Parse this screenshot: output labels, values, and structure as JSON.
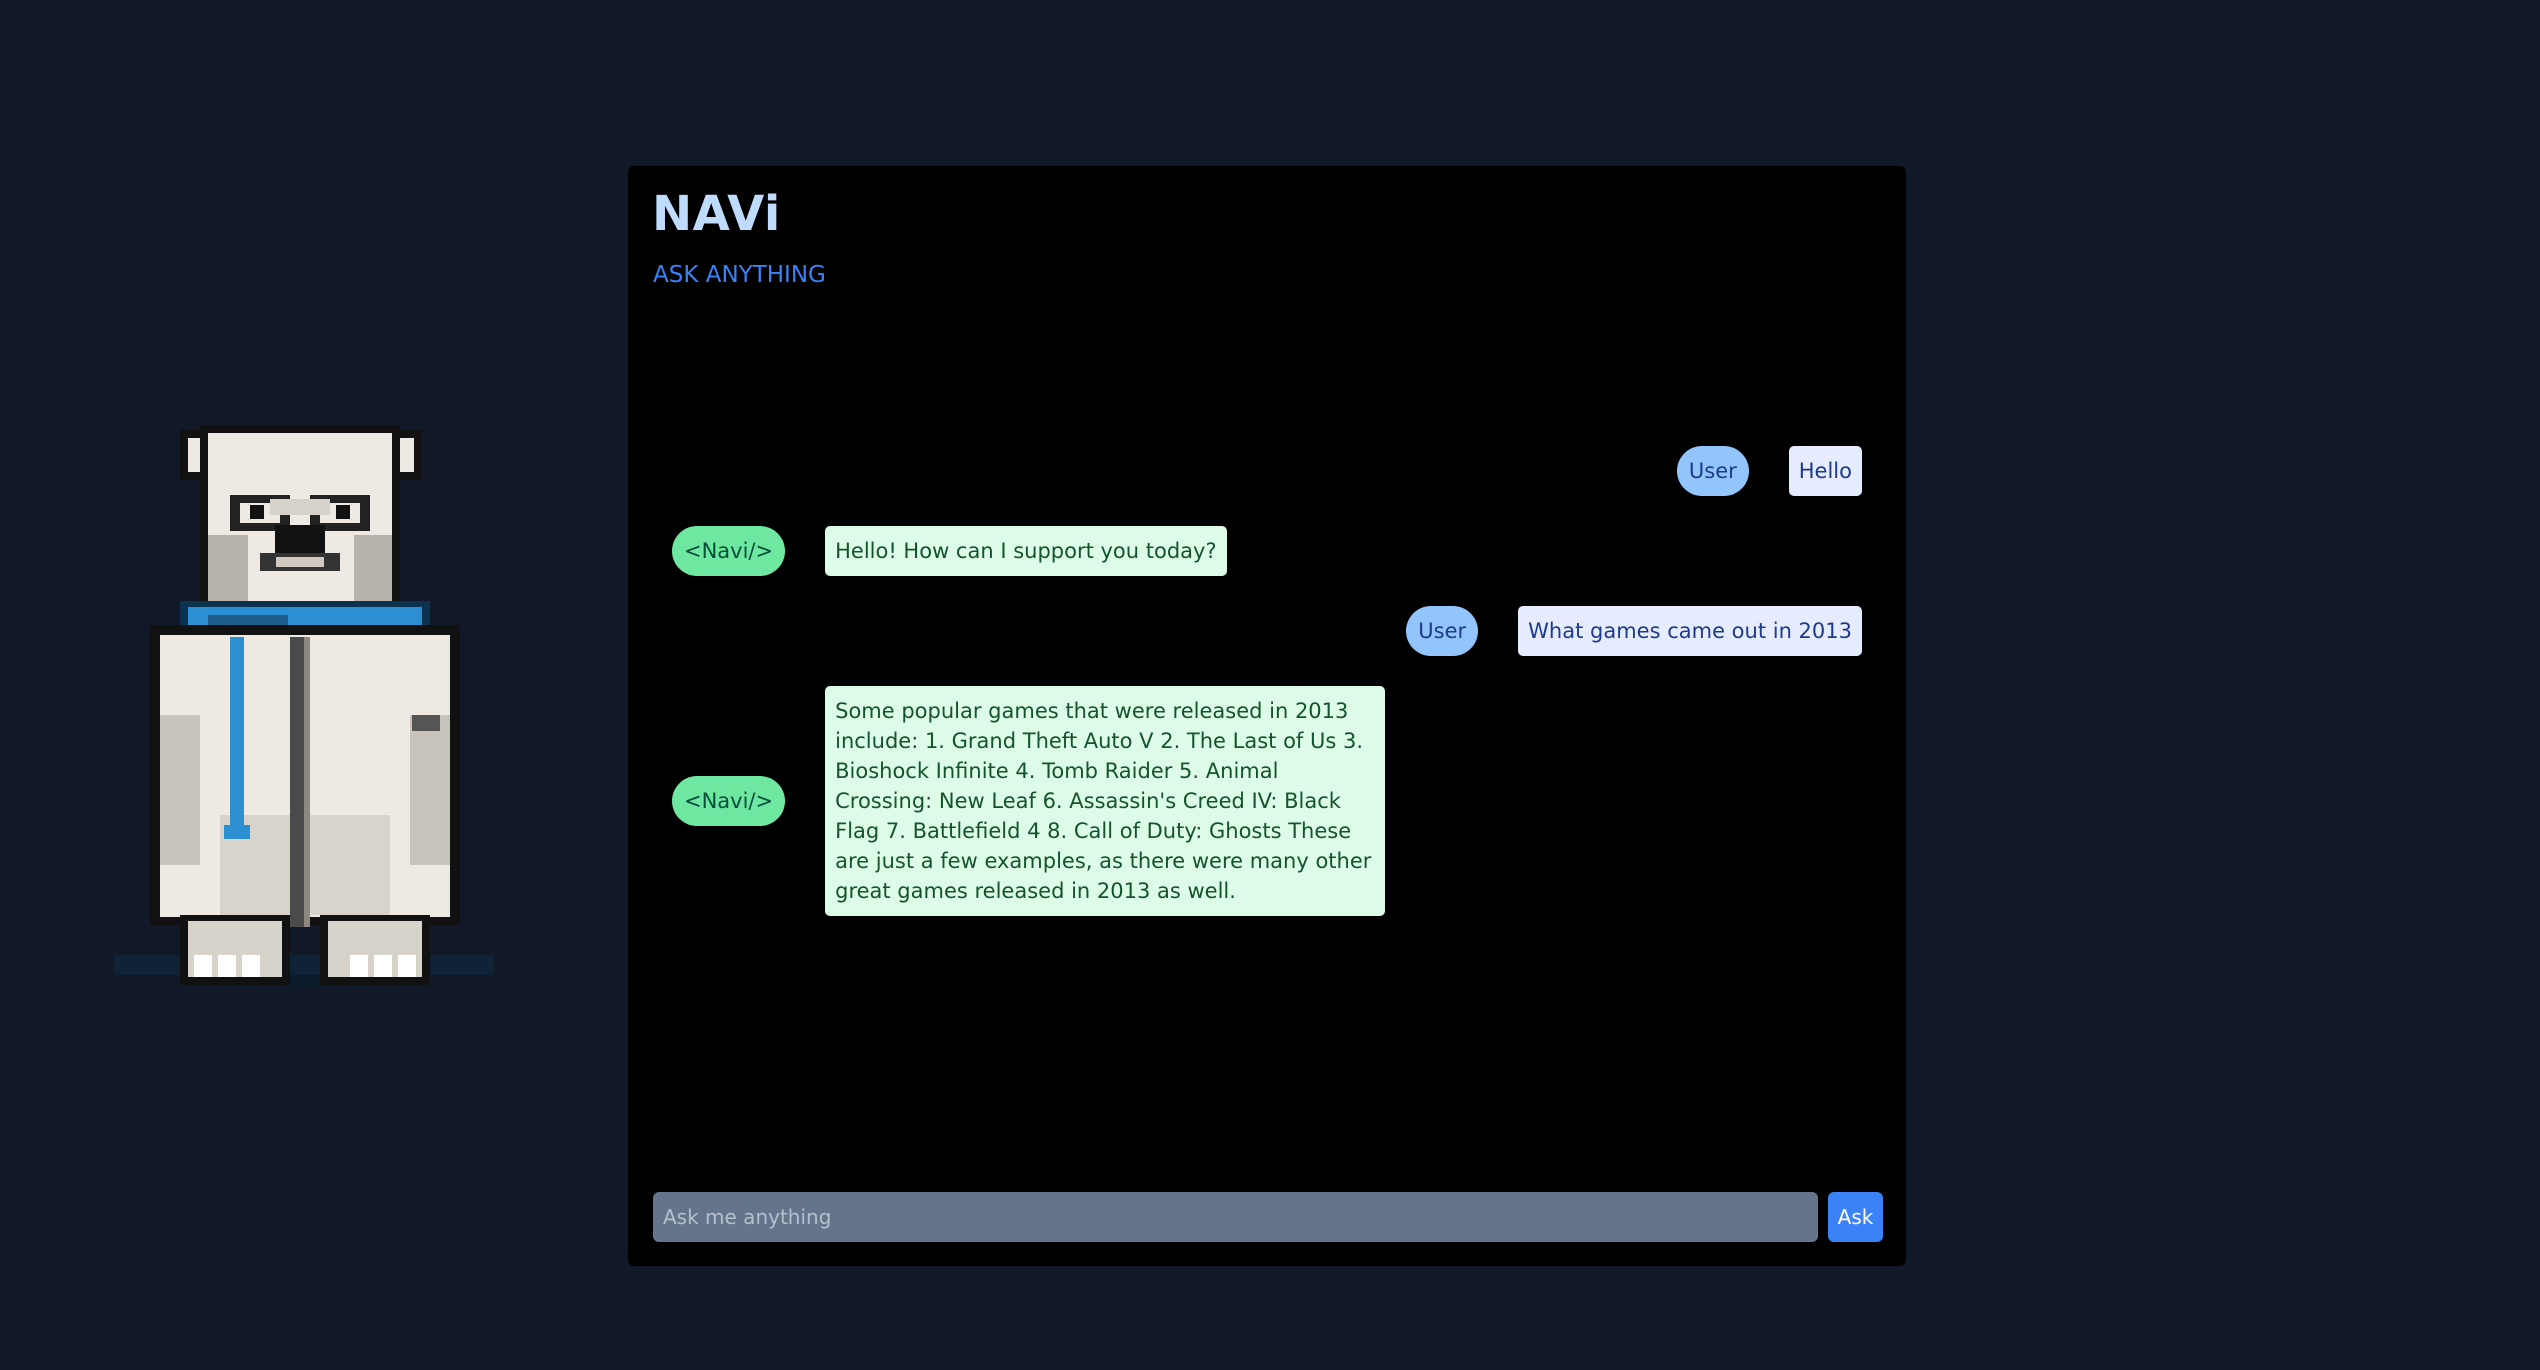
{
  "app": {
    "title": "NAVi",
    "subtitle": "ASK ANYTHING"
  },
  "colors": {
    "background": "#111827",
    "panel": "#000000",
    "title": "#bfdbfe",
    "subtitle_accent": "#3b82f6",
    "user_tag": "#93c5fd",
    "bot_tag": "#6ee7a0",
    "ask_button": "#3b82f6"
  },
  "mascot": {
    "icon": "polar-bear-pixel-art"
  },
  "messages": [
    {
      "sender": "user",
      "tag": "User",
      "text": "Hello"
    },
    {
      "sender": "bot",
      "tag": "<Navi/>",
      "text": "Hello! How can I support you today?"
    },
    {
      "sender": "user",
      "tag": "User",
      "text": "What games came out in 2013"
    },
    {
      "sender": "bot",
      "tag": "<Navi/>",
      "text": "Some popular games that were released in 2013 include: 1. Grand Theft Auto V 2. The Last of Us 3. Bioshock Infinite 4. Tomb Raider 5. Animal Crossing: New Leaf 6. Assassin's Creed IV: Black Flag 7. Battlefield 4 8. Call of Duty: Ghosts These are just a few examples, as there were many other great games released in 2013 as well."
    }
  ],
  "composer": {
    "placeholder": "Ask me anything",
    "value": "",
    "button_label": "Ask"
  }
}
